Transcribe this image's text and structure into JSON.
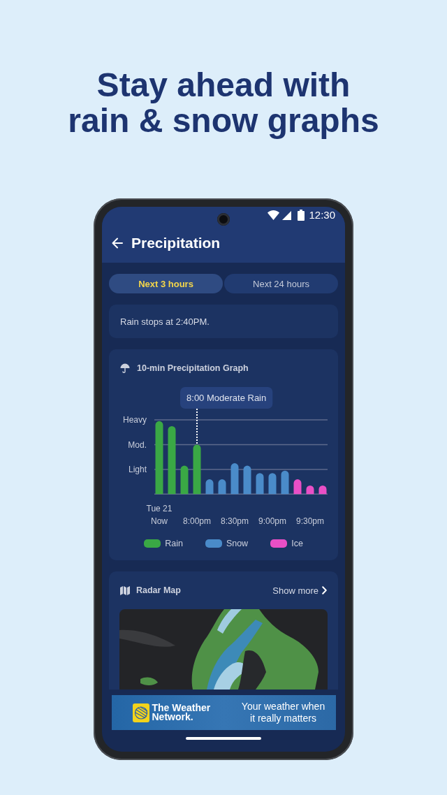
{
  "headline": {
    "lines": [
      "Stay ahead with",
      "rain & snow graphs"
    ]
  },
  "status_bar": {
    "time": "12:30"
  },
  "app_bar": {
    "title": "Precipitation"
  },
  "tabs": [
    {
      "label": "Next 3 hours",
      "selected": true
    },
    {
      "label": "Next 24 hours",
      "selected": false
    }
  ],
  "summary": {
    "text": "Rain stops at 2:40PM."
  },
  "graph_card": {
    "title": "10-min Precipitation Graph",
    "tooltip": "8:00 Moderate Rain",
    "y_labels": [
      "Heavy",
      "Mod.",
      "Light"
    ],
    "date_label": "Tue 21",
    "x_labels": [
      "Now",
      "8:00pm",
      "8:30pm",
      "9:00pm",
      "9:30pm"
    ],
    "legend": [
      {
        "name": "Rain",
        "color": "#3aa845"
      },
      {
        "name": "Snow",
        "color": "#4a8bc9"
      },
      {
        "name": "Ice",
        "color": "#e94fc6"
      }
    ]
  },
  "radar_card": {
    "title": "Radar Map",
    "link": "Show more"
  },
  "ad_banner": {
    "brand_lines": [
      "The Weather",
      "Network."
    ],
    "tagline_lines": [
      "Your weather when",
      "it really matters"
    ]
  }
}
